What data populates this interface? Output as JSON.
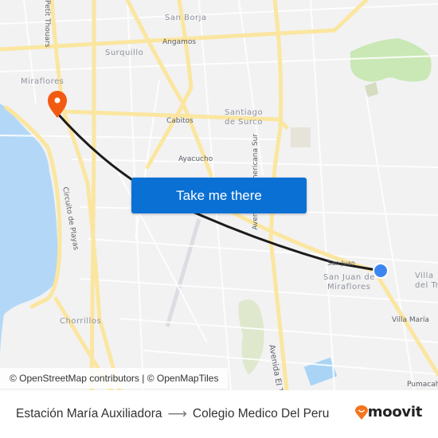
{
  "map": {
    "labels": {
      "san_borja": "San Borja",
      "angamos": "Angamos",
      "surquillo": "Surquillo",
      "petit_thouars": "Petit Thouars",
      "miraflores": "Miraflores",
      "cabitos": "Cabitos",
      "santiago_1": "Santiago",
      "santiago_2": "de Surco",
      "ayacucho": "Ayacucho",
      "panamericana": "Avenida Panamericana Sur",
      "circuito": "Circuito de Playas",
      "san_juan_street": "San Juan",
      "sjm_1": "San Juan de",
      "sjm_2": "Miraflores",
      "villa_1": "Villa",
      "villa_2": "del Tr",
      "villa_maria": "Villa María",
      "chorrillos": "Chorrillos",
      "avenida_el": "Avenida El T",
      "pumacahua": "Pumacahu"
    },
    "origin_marker": {
      "icon": "origin-dot-icon",
      "color": "#3d86f2"
    },
    "destination_marker": {
      "icon": "destination-pin-icon",
      "color": "#f25a12"
    },
    "route_color": "#1b1b1b",
    "cta_label": "Take me there",
    "cta_color": "#0a70d4",
    "attribution": "© OpenStreetMap contributors | © OpenMapTiles"
  },
  "footer": {
    "origin": "Estación María Auxiliadora",
    "arrow_icon": "arrow-right-icon",
    "destination": "Colegio Medico Del Peru",
    "brand": "moovit",
    "brand_color": "#f5741f"
  }
}
